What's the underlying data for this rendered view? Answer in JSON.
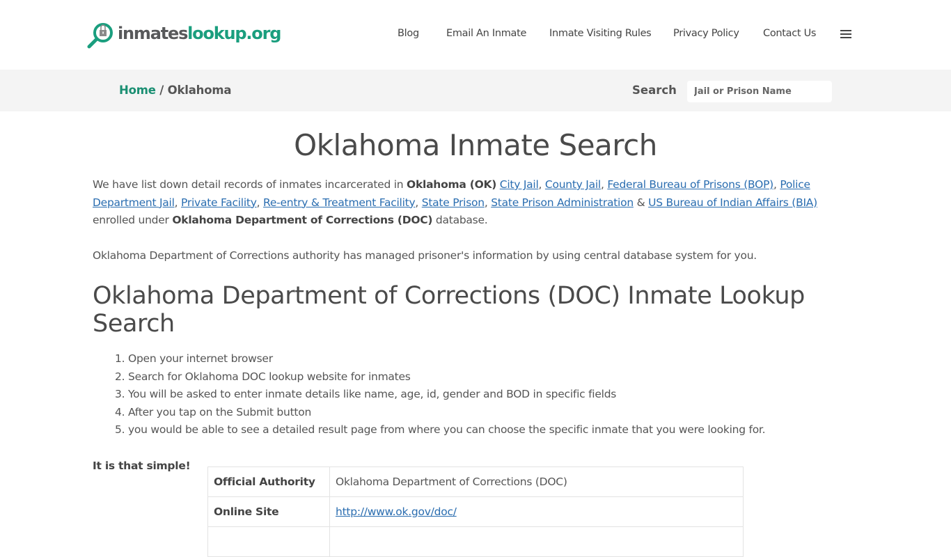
{
  "header": {
    "logo": {
      "part1": "inmates",
      "part2": "lookup.org",
      "icon": "magnifier-lock-icon"
    },
    "nav": [
      "Blog",
      "Email An Inmate",
      "Inmate Visiting Rules",
      "Privacy Policy",
      "Contact Us"
    ],
    "menu_icon": "hamburger-menu-icon"
  },
  "breadcrumb": {
    "home": "Home",
    "separator": " / ",
    "current": "Oklahoma"
  },
  "search": {
    "label": "Search",
    "placeholder": "Jail or Prison Name",
    "value": ""
  },
  "main": {
    "title": "Oklahoma Inmate Search",
    "intro": {
      "t1": "We have list down detail records of inmates incarcerated in ",
      "b1": "Oklahoma (OK)",
      "links": [
        "City Jail",
        "County Jail",
        "Federal Bureau of Prisons (BOP)",
        "Police Department Jail",
        "Private Facility",
        "Re-entry & Treatment Facility",
        "State Prison",
        "State Prison Administration",
        "US Bureau of Indian Affairs (BIA)"
      ],
      "amp": " & ",
      "t2": " enrolled under ",
      "b2": "Oklahoma Department of Corrections (DOC)",
      "t3": " database."
    },
    "paragraph2": "Oklahoma Department of Corrections authority has managed prisoner's information by using central database system for you.",
    "subtitle": "Oklahoma Department of Corrections (DOC) Inmate Lookup Search",
    "steps": [
      "Open your internet browser",
      "Search for Oklahoma DOC lookup website for inmates",
      "You will be asked to enter inmate details like name, age, id, gender and BOD in specific fields",
      "After you tap on the Submit button",
      "you would be able to see a detailed result page from where you can choose the specific inmate that you were looking for."
    ],
    "simple": "It is that simple!",
    "table": [
      {
        "key": "Official Authority",
        "value": "Oklahoma Department of Corrections (DOC)",
        "link": false
      },
      {
        "key": "Online Site",
        "value": "http://www.ok.gov/doc/",
        "link": true
      },
      {
        "key": "",
        "value": "",
        "link": false
      }
    ]
  },
  "colors": {
    "brand_green": "#1a9e7e",
    "link_blue": "#2a6db0",
    "text": "#555555",
    "bar_bg": "#f4f4f4"
  }
}
